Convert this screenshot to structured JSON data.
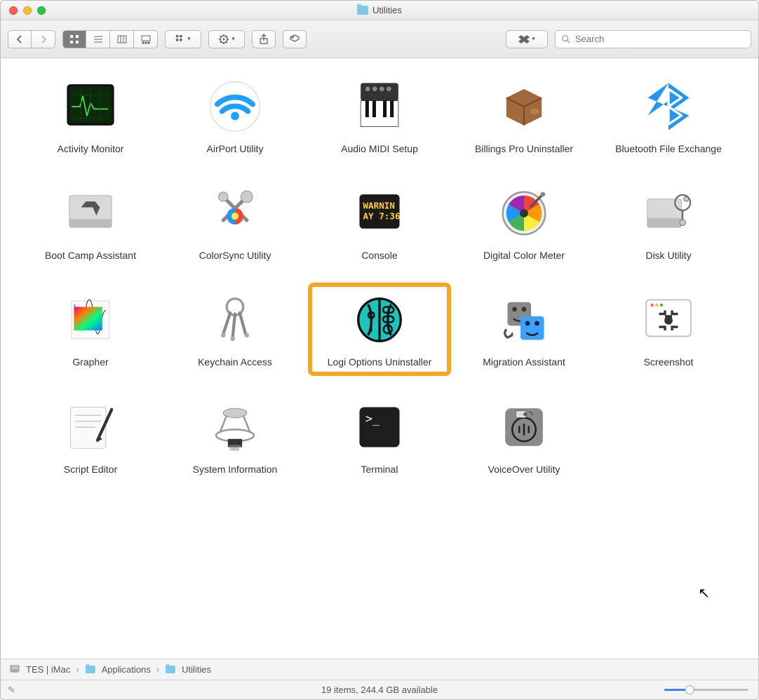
{
  "window": {
    "title": "Utilities"
  },
  "search": {
    "placeholder": "Search"
  },
  "path": [
    {
      "name": "TES | iMac",
      "icon": "disk"
    },
    {
      "name": "Applications",
      "icon": "folder"
    },
    {
      "name": "Utilities",
      "icon": "folder"
    }
  ],
  "status": {
    "text": "19 items, 244.4 GB available"
  },
  "items": [
    {
      "label": "Activity Monitor",
      "icon": "activity-monitor",
      "highlight": false
    },
    {
      "label": "AirPort Utility",
      "icon": "airport",
      "highlight": false
    },
    {
      "label": "Audio MIDI Setup",
      "icon": "audio-midi",
      "highlight": false
    },
    {
      "label": "Billings Pro Uninstaller",
      "icon": "box",
      "highlight": false
    },
    {
      "label": "Bluetooth File Exchange",
      "icon": "bluetooth",
      "highlight": false
    },
    {
      "label": "Boot Camp Assistant",
      "icon": "bootcamp",
      "highlight": false
    },
    {
      "label": "ColorSync Utility",
      "icon": "colorsync",
      "highlight": false
    },
    {
      "label": "Console",
      "icon": "console",
      "highlight": false
    },
    {
      "label": "Digital Color Meter",
      "icon": "color-meter",
      "highlight": false
    },
    {
      "label": "Disk Utility",
      "icon": "disk-utility",
      "highlight": false
    },
    {
      "label": "Grapher",
      "icon": "grapher",
      "highlight": false
    },
    {
      "label": "Keychain Access",
      "icon": "keychain",
      "highlight": false
    },
    {
      "label": "Logi Options Uninstaller",
      "icon": "logi",
      "highlight": true
    },
    {
      "label": "Migration Assistant",
      "icon": "migration",
      "highlight": false
    },
    {
      "label": "Screenshot",
      "icon": "screenshot",
      "highlight": false
    },
    {
      "label": "Script Editor",
      "icon": "script-editor",
      "highlight": false
    },
    {
      "label": "System Information",
      "icon": "system-info",
      "highlight": false
    },
    {
      "label": "Terminal",
      "icon": "terminal",
      "highlight": false
    },
    {
      "label": "VoiceOver Utility",
      "icon": "voiceover",
      "highlight": false
    }
  ]
}
